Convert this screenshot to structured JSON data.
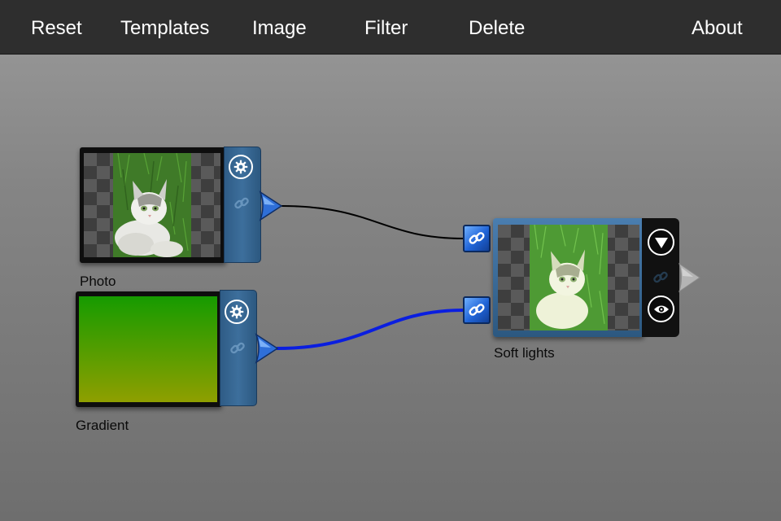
{
  "toolbar": {
    "reset": "Reset",
    "templates": "Templates",
    "image": "Image",
    "filter": "Filter",
    "delete": "Delete",
    "about": "About"
  },
  "nodes": {
    "photo": {
      "label": "Photo"
    },
    "gradient": {
      "label": "Gradient",
      "gradient_top": "#169b00",
      "gradient_bottom": "#8f9f00"
    },
    "soft_lights": {
      "label": "Soft lights"
    }
  },
  "colors": {
    "toolbar_bg": "#2e2e2e",
    "panel_blue": "#3d6f9c",
    "active_wire": "#0a1ee0",
    "inactive_wire": "#000000"
  },
  "icons": {
    "settings": "gear-icon",
    "link": "chain-link-icon",
    "dropdown": "triangle-down-icon",
    "preview": "eye-icon"
  }
}
